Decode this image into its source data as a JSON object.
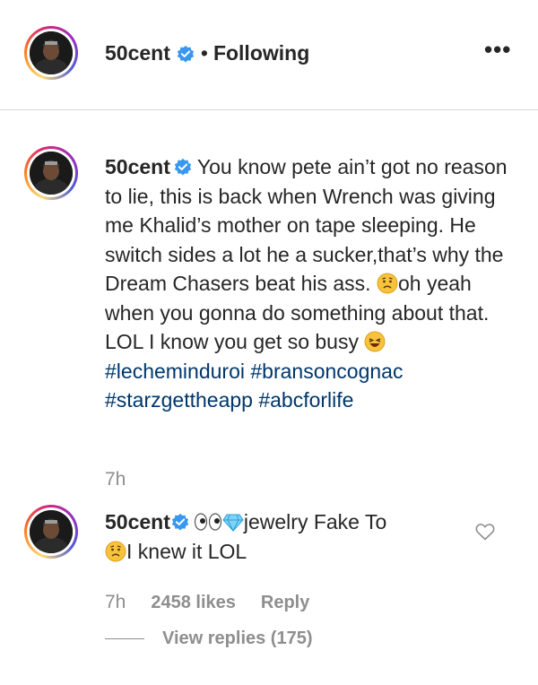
{
  "post_header": {
    "username": "50cent",
    "separator": "•",
    "follow_status": "Following",
    "more_label": "•••"
  },
  "caption": {
    "username": "50cent",
    "text_1": "You know pete ain’t got no reason to lie, this is back when Wrench was giving me Khalid’s mother on tape sleeping. He switch sides a lot he a sucker,that’s why the Dream Chasers beat his ass.",
    "text_2": "oh yeah when you gonna do something about that. LOL I know you get so busy",
    "hashtags": [
      "#lecheminduroi",
      "#bransoncognac",
      "#starzgettheapp",
      "#abcforlife"
    ],
    "timestamp": "7h"
  },
  "comment": {
    "username": "50cent",
    "text_1": "jewelry Fake To",
    "text_2": "I knew it LOL",
    "timestamp": "7h",
    "likes": "2458 likes",
    "reply_label": "Reply",
    "view_replies": "View replies (175)"
  },
  "icons": {
    "verified": "verified-badge-icon",
    "more": "more-options-icon",
    "heart": "heart-outline-icon",
    "emoji_worried": "worried-face-emoji",
    "emoji_laugh": "laughing-face-emoji",
    "emoji_eyes": "eyes-emoji",
    "emoji_gem": "gem-emoji"
  },
  "colors": {
    "verified_blue": "#3897f0",
    "hashtag": "#00376b",
    "secondary_text": "#8e8e8e",
    "primary_text": "#262626"
  }
}
